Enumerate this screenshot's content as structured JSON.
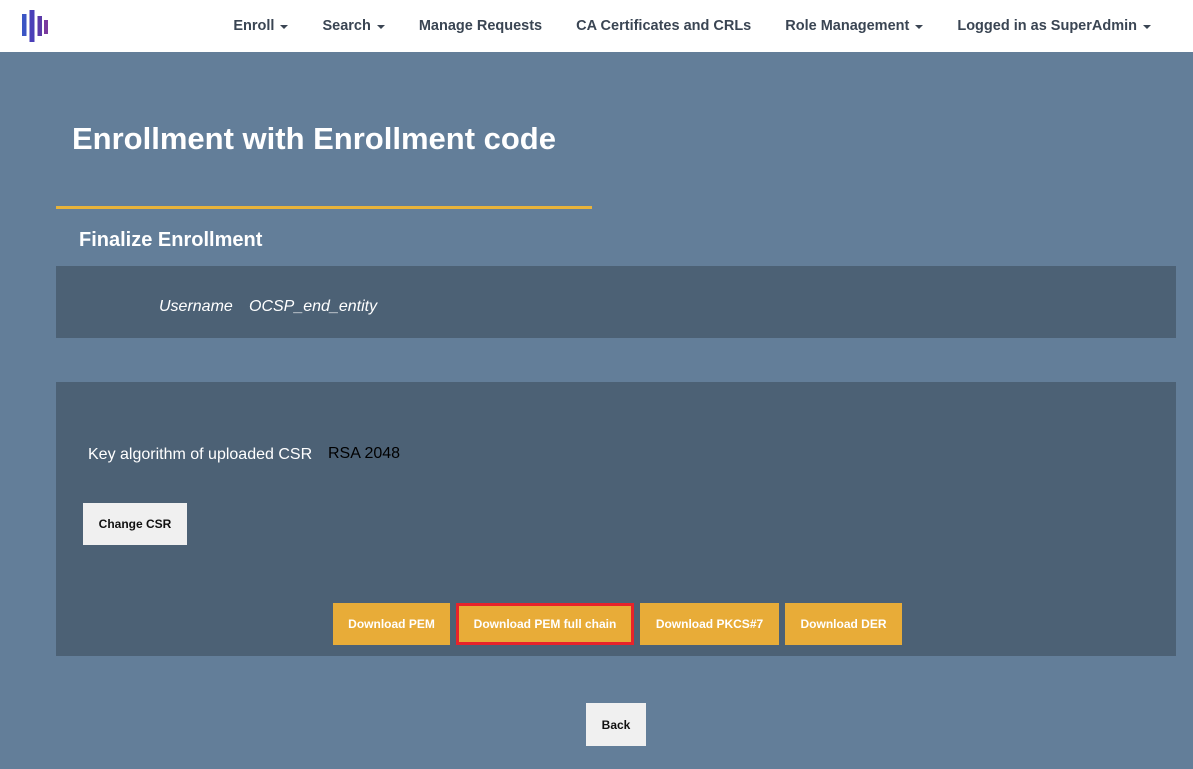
{
  "nav": {
    "logo_icon": "bars-logo-icon",
    "items": [
      {
        "label": "Enroll",
        "dropdown": true
      },
      {
        "label": "Search",
        "dropdown": true
      },
      {
        "label": "Manage Requests",
        "dropdown": false
      },
      {
        "label": "CA Certificates and CRLs",
        "dropdown": false
      },
      {
        "label": "Role Management",
        "dropdown": true
      },
      {
        "label": "Logged in as SuperAdmin",
        "dropdown": true
      }
    ]
  },
  "page": {
    "title": "Enrollment with Enrollment code",
    "section_title": "Finalize Enrollment"
  },
  "user": {
    "label": "Username",
    "value": "OCSP_end_entity"
  },
  "csr": {
    "key_label": "Key algorithm of uploaded CSR",
    "key_value": "RSA 2048",
    "change_label": "Change CSR"
  },
  "downloads": {
    "pem": "Download PEM",
    "pem_full_chain": "Download PEM full chain",
    "pkcs7": "Download PKCS#7",
    "der": "Download DER"
  },
  "back_label": "Back",
  "colors": {
    "background": "#637e99",
    "panel": "#4c6175",
    "accent": "#e8ac38",
    "highlight": "#e8232a"
  }
}
